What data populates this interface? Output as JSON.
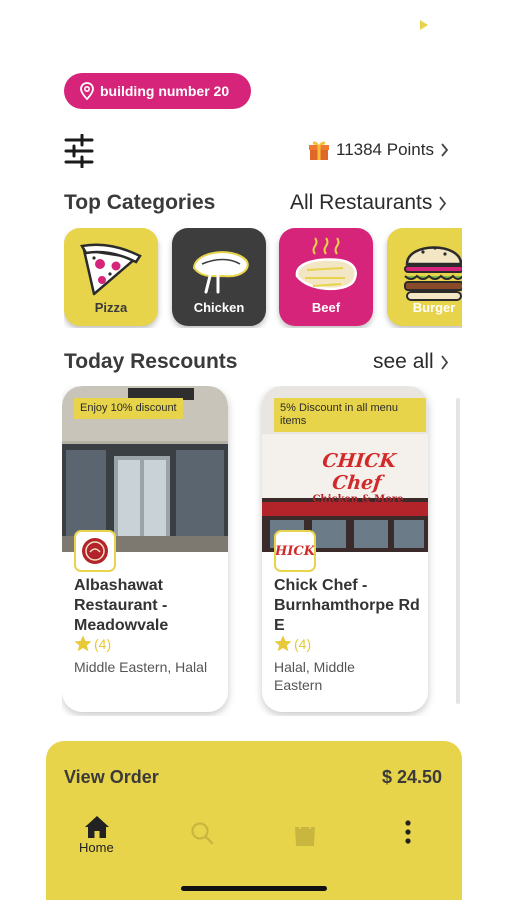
{
  "location": {
    "label": "building number 20"
  },
  "rewards": {
    "points_label": "11384 Points"
  },
  "sections": {
    "categories": {
      "title": "Top Categories",
      "link": "All Restaurants"
    },
    "rescounts": {
      "title": "Today Rescounts",
      "link": "see all"
    }
  },
  "categories": [
    {
      "label": "Pizza",
      "icon": "pizza-icon",
      "color": "#e8d44b"
    },
    {
      "label": "Chicken",
      "icon": "chicken-icon",
      "color": "#3d3d3d"
    },
    {
      "label": "Beef",
      "icon": "beef-icon",
      "color": "#d6247a"
    },
    {
      "label": "Burger",
      "icon": "burger-icon",
      "color": "#e8d44b"
    }
  ],
  "restaurants": [
    {
      "badge": "Enjoy 10% discount",
      "name": "Albashawat Restaurant - Meadowvale",
      "rating_count": "(4)",
      "tags": "Middle Eastern, Halal"
    },
    {
      "badge": "5% Discount in all menu items",
      "name": "Chick Chef - Burnhamthorpe Rd E",
      "rating_count": "(4)",
      "tags": "Halal, Middle Eastern",
      "sign_text": "CHICK Chef",
      "sign_sub": "Chicken & More",
      "logo_text": "HICK"
    }
  ],
  "order": {
    "label": "View Order",
    "total": "$ 24.50"
  },
  "nav": {
    "home_label": "Home"
  },
  "colors": {
    "accent_yellow": "#e8d44b",
    "accent_pink": "#d6247a",
    "dark": "#3d3d3d"
  }
}
